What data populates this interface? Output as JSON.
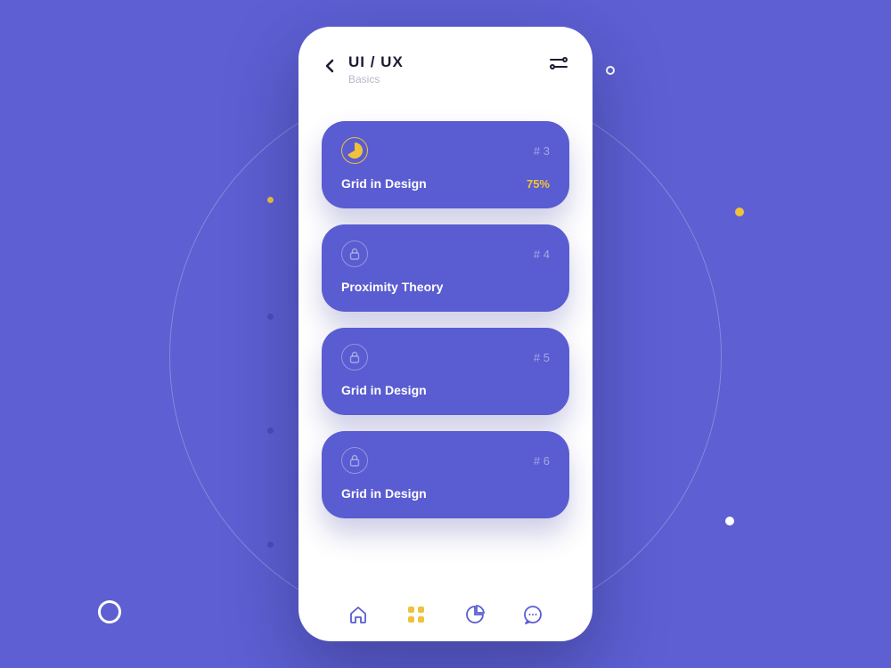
{
  "colors": {
    "bg": "#5d5fd3",
    "card": "#5a5cd1",
    "accent": "#f0c23c",
    "text_dark": "#1b1b32",
    "text_muted": "#b8b8c8"
  },
  "header": {
    "title": "UI / UX",
    "subtitle": "Basics"
  },
  "lessons": [
    {
      "number": "# 3",
      "title": "Grid in Design",
      "progress": "75%",
      "state": "active"
    },
    {
      "number": "# 4",
      "title": "Proximity Theory",
      "progress": "",
      "state": "locked"
    },
    {
      "number": "# 5",
      "title": "Grid in Design",
      "progress": "",
      "state": "locked"
    },
    {
      "number": "# 6",
      "title": "Grid in Design",
      "progress": "",
      "state": "locked"
    }
  ],
  "nav": {
    "items": [
      "home",
      "grid",
      "chart",
      "chat"
    ],
    "active": "grid"
  }
}
